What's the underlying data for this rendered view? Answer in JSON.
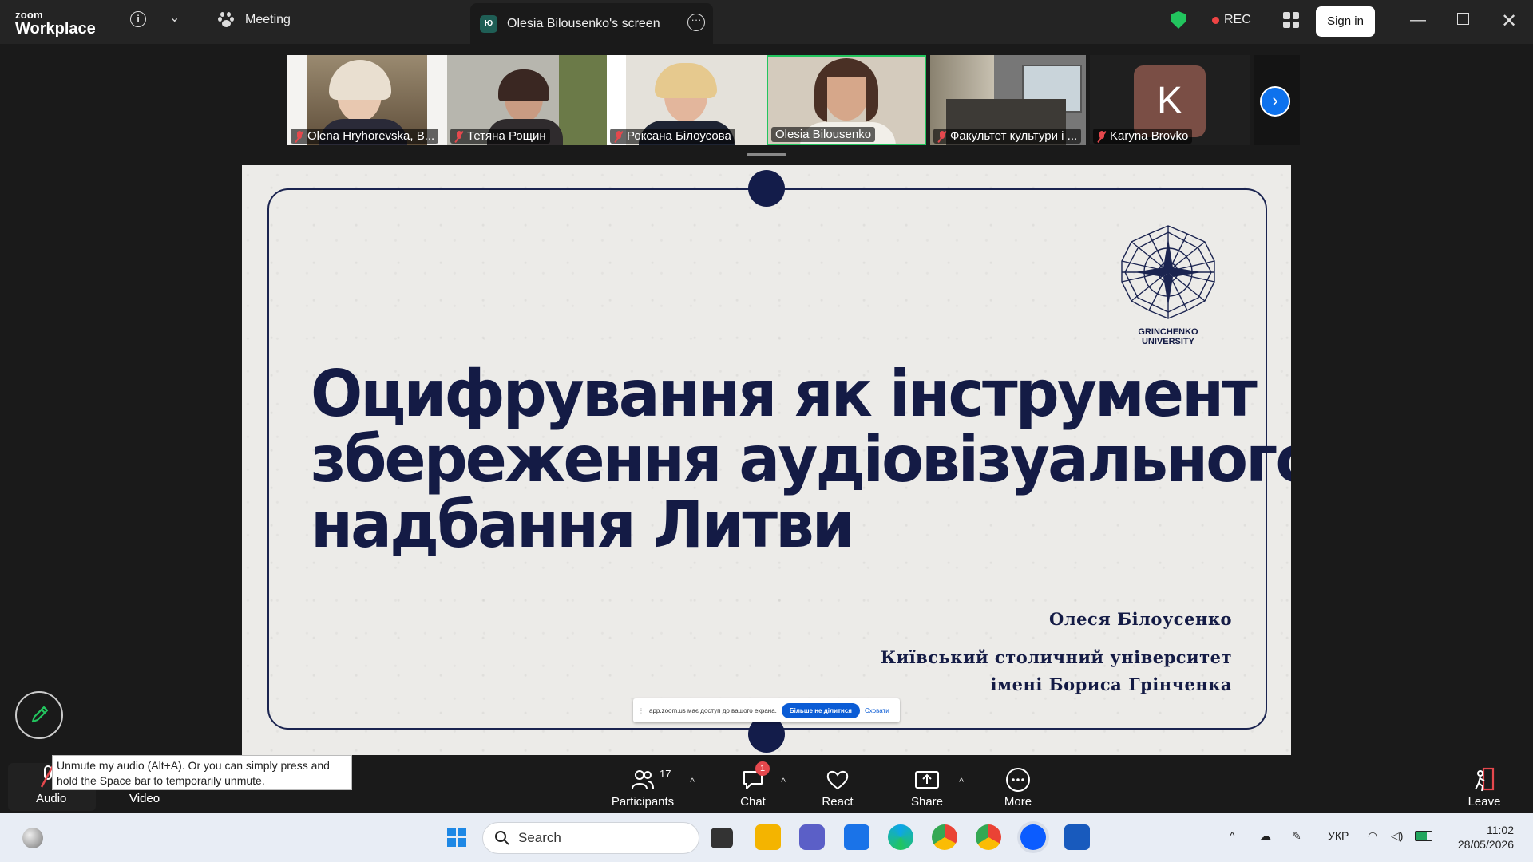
{
  "app": {
    "logo_small": "zoom",
    "logo_big": "Workplace",
    "meeting_label": "Meeting",
    "screen_tab_badge": "Ю",
    "screen_tab_label": "Olesia Bilousenko's screen",
    "rec_label": "REC",
    "signin_label": "Sign in",
    "accent_color": "#0e72ed"
  },
  "participants_strip": [
    {
      "name": "Olena Hryhorevska, B...",
      "muted": true,
      "bg": "#8a7a60"
    },
    {
      "name": "Тетяна Рощин",
      "muted": true,
      "bg": "#a9a9a2"
    },
    {
      "name": "Роксана Білоусова",
      "muted": true,
      "bg": "#d9d6cf"
    },
    {
      "name": "Olesia Bilousenko",
      "muted": false,
      "bg": "#c9c1b4",
      "active": true
    },
    {
      "name": "Факультет культури і ...",
      "muted": true,
      "bg": "#6f7172"
    },
    {
      "name": "Karyna Brovko",
      "muted": true,
      "bg": "#1f1f1f",
      "initial": "K"
    }
  ],
  "slide": {
    "title_lines": [
      "Оцифрування як інструмент",
      "збереження аудіовізуального",
      "надбання Литви"
    ],
    "logo_name_line1": "GRINCHENKO",
    "logo_name_line2": "UNIVERSITY",
    "author": "Олеся Білоусенко",
    "affiliation_line1": "Київський столичний університет",
    "affiliation_line2": "імені Бориса Грінченка"
  },
  "share_banner": {
    "text": "app.zoom.us має доступ до вашого екрана.",
    "stop_label": "Більше не ділитися",
    "hide_label": "Сховати"
  },
  "tooltip": "Unmute my audio (Alt+A). Or you can simply press and hold the Space bar to temporarily unmute.",
  "toolbar": {
    "audio": "Audio",
    "video": "Video",
    "participants": "Participants",
    "participants_count": "17",
    "chat": "Chat",
    "chat_badge": "1",
    "react": "React",
    "share": "Share",
    "more": "More",
    "leave": "Leave"
  },
  "taskbar": {
    "search_placeholder": "Search",
    "lang": "УКР",
    "time": "11:02",
    "date": "28/05/2026"
  }
}
